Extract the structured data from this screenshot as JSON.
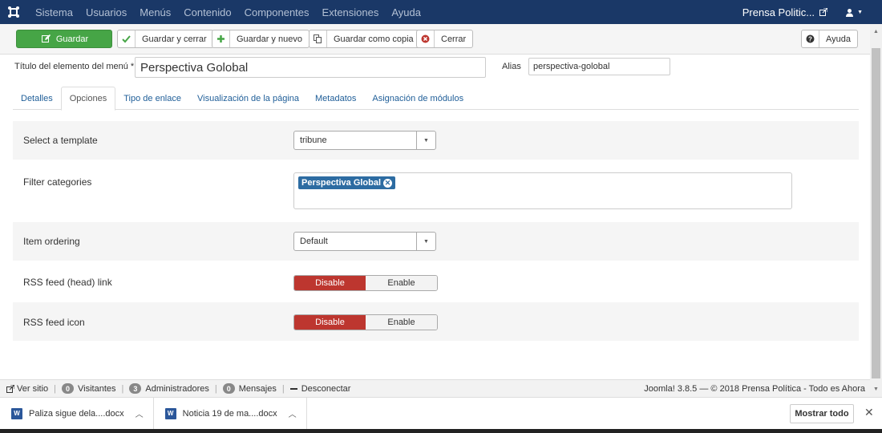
{
  "topbar": {
    "menu": [
      "Sistema",
      "Usuarios",
      "Menús",
      "Contenido",
      "Componentes",
      "Extensiones",
      "Ayuda"
    ],
    "site_name": "Prensa Politic...",
    "bg_color": "#1a3867"
  },
  "toolbar": {
    "save": "Guardar",
    "save_close": "Guardar y cerrar",
    "save_new": "Guardar y nuevo",
    "save_copy": "Guardar como copia",
    "close": "Cerrar",
    "help": "Ayuda"
  },
  "form": {
    "title_label": "Título del elemento del menú *",
    "title_value": "Perspectiva Golobal",
    "alias_label": "Alias",
    "alias_value": "perspectiva-golobal"
  },
  "tabs": [
    "Detalles",
    "Opciones",
    "Tipo de enlace",
    "Visualización de la página",
    "Metadatos",
    "Asignación de módulos"
  ],
  "active_tab": "Opciones",
  "options": {
    "template_label": "Select a template",
    "template_value": "tribune",
    "filter_label": "Filter categories",
    "filter_chip": "Perspectiva Global",
    "ordering_label": "Item ordering",
    "ordering_value": "Default",
    "rss_link_label": "RSS feed (head) link",
    "rss_icon_label": "RSS feed icon",
    "disable": "Disable",
    "enable": "Enable"
  },
  "status": {
    "view_site": "Ver sitio",
    "visitors_count": "0",
    "visitors": "Visitantes",
    "admins_count": "3",
    "admins": "Administradores",
    "messages_count": "0",
    "messages": "Mensajes",
    "logout": "Desconectar",
    "copyright": "Joomla! 3.8.5 — © 2018 Prensa Política - Todo es Ahora"
  },
  "downloads": {
    "file1": "Paliza sigue dela....docx",
    "file2": "Noticia 19 de ma....docx",
    "show_all": "Mostrar todo"
  }
}
